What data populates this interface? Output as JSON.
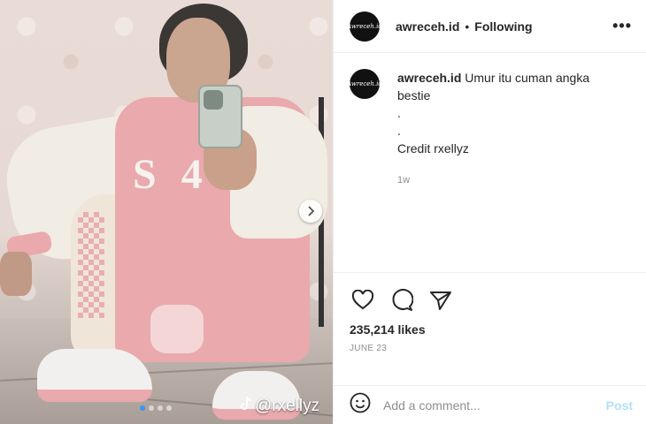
{
  "post": {
    "username": "awreceh.id",
    "separator": "•",
    "follow_status": "Following",
    "more_label": "•••",
    "avatar_label": "Awreceh.id"
  },
  "caption": {
    "username": "awreceh.id",
    "text": "Umur itu cuman angka bestie",
    "lines": [
      ".",
      ".",
      "Credit rxellyz"
    ],
    "time_ago": "1w"
  },
  "media": {
    "watermark": "@rxellyz",
    "carousel_count": 4,
    "active_index": 0
  },
  "engagement": {
    "likes": "235,214 likes",
    "date": "JUNE 23"
  },
  "comment": {
    "placeholder": "Add a comment...",
    "post_label": "Post"
  },
  "colors": {
    "accent": "#3897f0",
    "post_disabled": "#b2dffc",
    "muted": "#8e8e8e"
  },
  "icons": [
    "more-options-icon",
    "heart-icon",
    "comment-icon",
    "share-icon",
    "emoji-icon",
    "next-arrow-icon",
    "tiktok-icon"
  ]
}
